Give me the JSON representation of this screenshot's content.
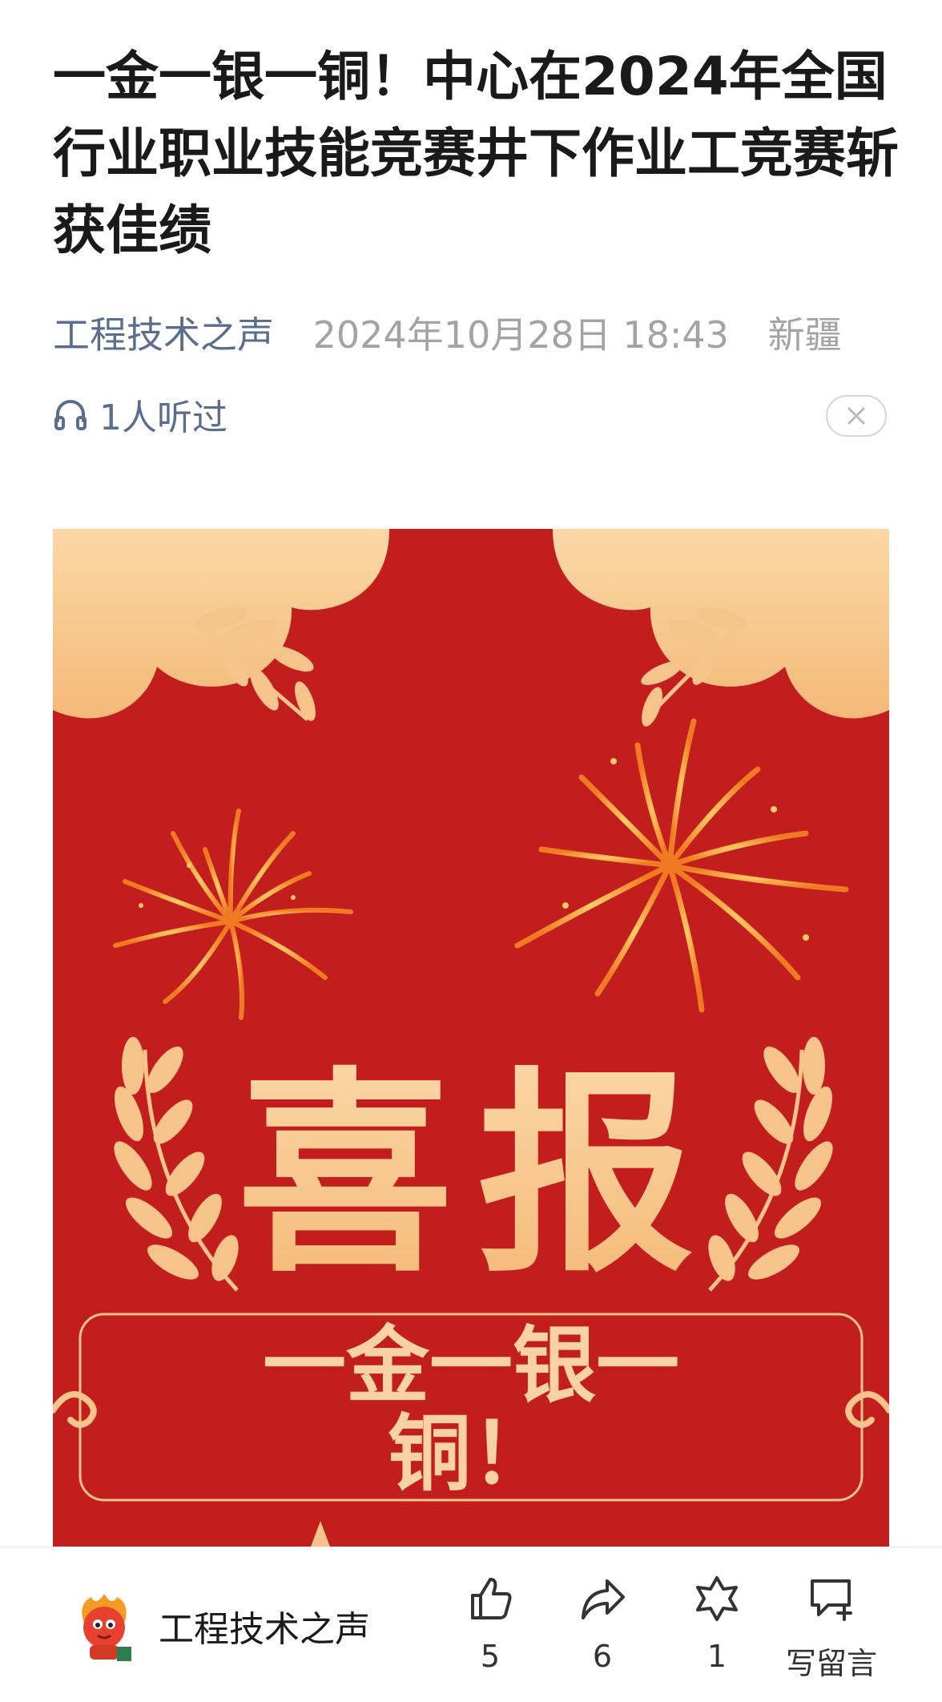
{
  "article": {
    "title": "一金一银一铜！中心在2024年全国行业职业技能竞赛井下作业工竞赛斩获佳绩",
    "account": "工程技术之声",
    "datetime": "2024年10月28日 18:43",
    "region": "新疆",
    "listen_count": "1人听过"
  },
  "poster": {
    "headline": "喜报",
    "medals_line1": "一金一银一",
    "medals_line2": "铜！"
  },
  "bottom_bar": {
    "account": "工程技术之声",
    "like_count": "5",
    "share_count": "6",
    "favorite_count": "1",
    "comment_label": "写留言"
  },
  "colors": {
    "poster_red": "#c21e1e",
    "gold": "#f7c98d",
    "link_blue": "#5a6d8e"
  },
  "icons": [
    "headphone-icon",
    "close-icon",
    "like-icon",
    "share-icon",
    "favorite-icon",
    "comment-icon"
  ]
}
